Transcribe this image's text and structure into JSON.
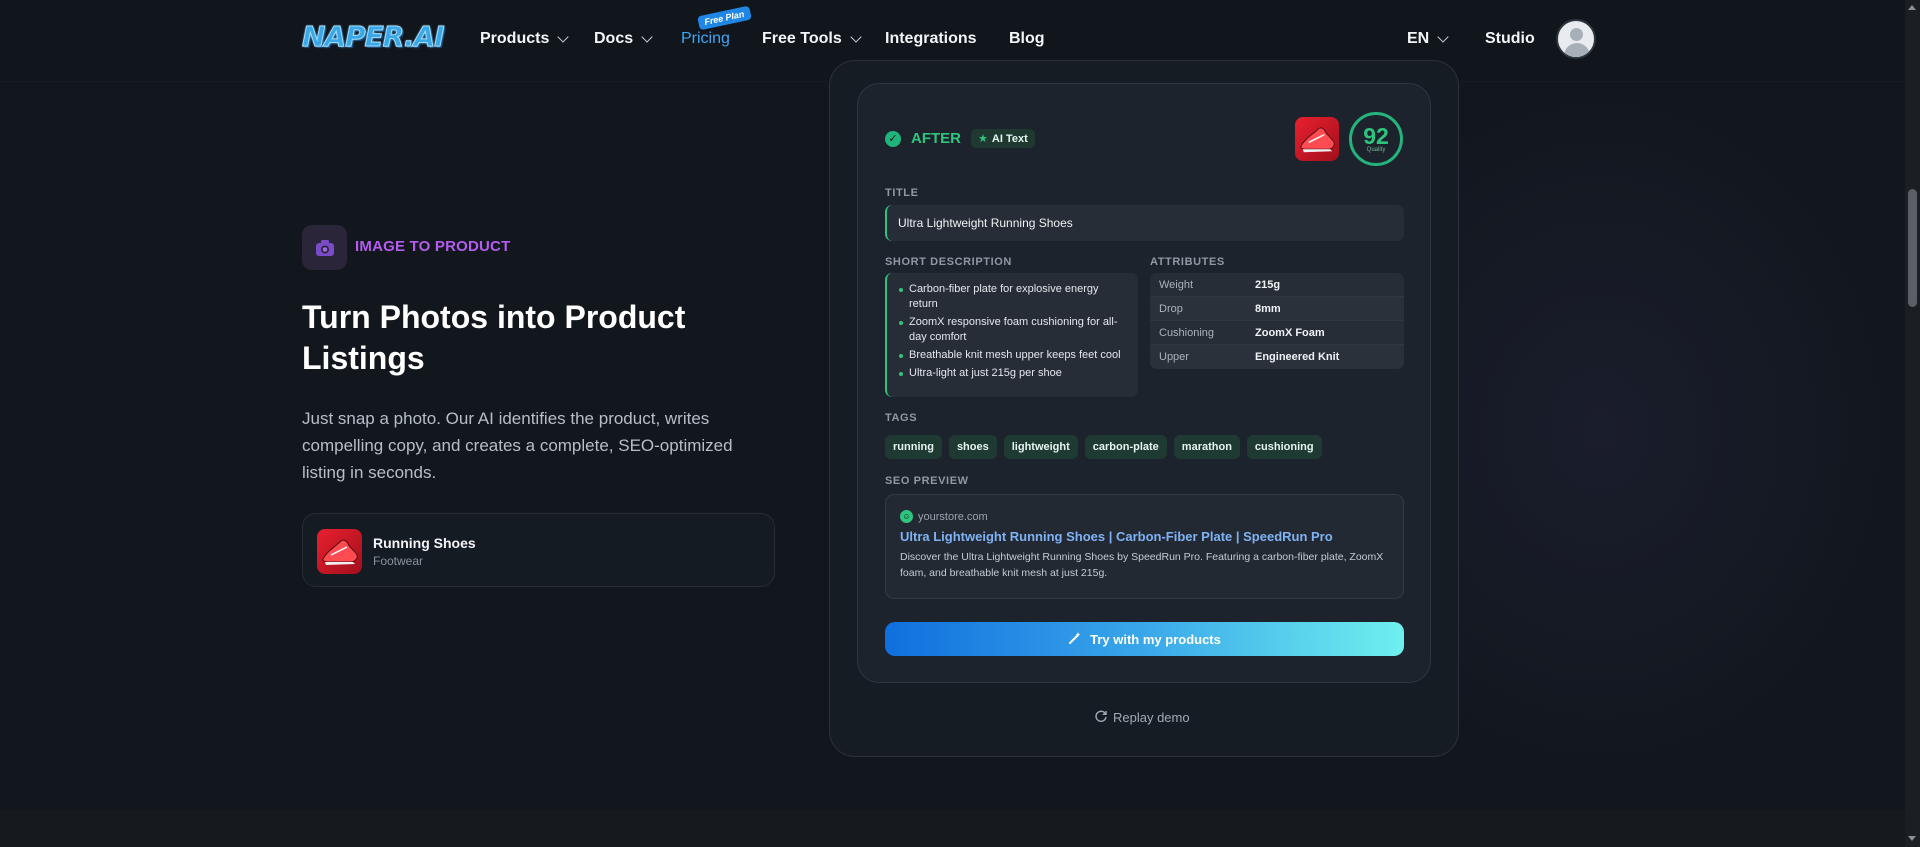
{
  "nav": {
    "logo": "NAPER.AI",
    "items": [
      {
        "label": "Products",
        "dropdown": true
      },
      {
        "label": "Docs",
        "dropdown": true
      },
      {
        "label": "Pricing",
        "badge": "Free Plan"
      },
      {
        "label": "Free Tools",
        "dropdown": true
      },
      {
        "label": "Integrations"
      },
      {
        "label": "Blog"
      }
    ],
    "language": "EN",
    "studio": "Studio"
  },
  "feature": {
    "icon": "camera-icon",
    "label": "IMAGE TO PRODUCT",
    "headline": "Turn Photos into Product Listings",
    "description": "Just snap a photo. Our AI identifies the product, writes compelling copy, and creates a complete, SEO-optimized listing in seconds.",
    "product_card": {
      "name": "Running Shoes",
      "category": "Footwear"
    }
  },
  "demo": {
    "status": "AFTER",
    "badge": "AI Text",
    "score": "92",
    "score_label": "Quality",
    "title_label": "TITLE",
    "title": "Ultra Lightweight Running Shoes",
    "short_description_label": "SHORT DESCRIPTION",
    "bullets": [
      "Carbon-fiber plate for explosive energy return",
      "ZoomX responsive foam cushioning for all-day comfort",
      "Breathable knit mesh upper keeps feet cool",
      "Ultra-light at just 215g per shoe"
    ],
    "attributes_label": "ATTRIBUTES",
    "attributes": [
      {
        "key": "Weight",
        "value": "215g"
      },
      {
        "key": "Drop",
        "value": "8mm"
      },
      {
        "key": "Cushioning",
        "value": "ZoomX Foam"
      },
      {
        "key": "Upper",
        "value": "Engineered Knit"
      }
    ],
    "tags_label": "TAGS",
    "tags": [
      "running",
      "shoes",
      "lightweight",
      "carbon-plate",
      "marathon",
      "cushioning"
    ],
    "seo_label": "SEO PREVIEW",
    "seo": {
      "domain": "yourstore.com",
      "title": "Ultra Lightweight Running Shoes | Carbon-Fiber Plate | SpeedRun Pro",
      "description": "Discover the Ultra Lightweight Running Shoes by SpeedRun Pro. Featuring a carbon-fiber plate, ZoomX foam, and breathable knit mesh at just 215g."
    },
    "cta": "Try with my products",
    "replay": "Replay demo"
  },
  "colors": {
    "background": "#12171e",
    "accent_green": "#2fc47e",
    "accent_purple": "#b45cf0",
    "accent_blue": "#3ea6f4"
  }
}
